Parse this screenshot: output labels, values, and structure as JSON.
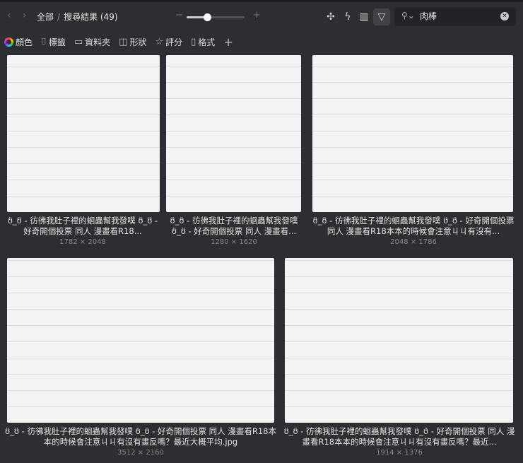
{
  "toolbar": {
    "back_icon": "chevron-left-icon",
    "forward_icon": "chevron-right-icon",
    "breadcrumb_root": "全部",
    "breadcrumb_current": "搜尋結果 (49)",
    "zoom_minus": "−",
    "zoom_plus": "+",
    "zoom_level": 0.35,
    "search_value": "肉棒"
  },
  "filters": [
    {
      "label": "顏色",
      "icon": "color-ring-icon"
    },
    {
      "label": "標籤",
      "icon": "bookmark-icon"
    },
    {
      "label": "資料夾",
      "icon": "folder-icon"
    },
    {
      "label": "形狀",
      "icon": "shape-icon"
    },
    {
      "label": "評分",
      "icon": "star-icon"
    },
    {
      "label": "格式",
      "icon": "file-format-icon"
    }
  ],
  "items": [
    {
      "caption": "ʊ̈_ʊ̈ - 彷彿我肚子裡的蛔蟲幫我發噗 ʊ̈_ʊ̈ - 好奇開個投票 同人 漫畫看R18...",
      "size": "1782 × 2048"
    },
    {
      "caption": "ʊ̈_ʊ̈ - 彷彿我肚子裡的蛔蟲幫我發噗 ʊ̈_ʊ̈ - 好奇開個投票 同人 漫畫看...",
      "size": "1280 × 1620"
    },
    {
      "caption": "ʊ̈_ʊ̈ - 彷彿我肚子裡的蛔蟲幫我發噗 ʊ̈_ʊ̈ - 好奇開個投票 同人 漫畫看R18本本的時候會注意ㄐㄐ有沒有...",
      "size": "2048 × 1786"
    },
    {
      "caption": "ʊ̈_ʊ̈ - 彷彿我肚子裡的蛔蟲幫我發噗 ʊ̈_ʊ̈ - 好奇開個投票 同人 漫畫看R18本本的時候會注意ㄐㄐ有沒有畫反嗎？最近大概平均.jpg",
      "size": "3512 × 2160"
    },
    {
      "caption": "ʊ̈_ʊ̈ - 彷彿我肚子裡的蛔蟲幫我發噗 ʊ̈_ʊ̈ - 好奇開個投票 同人 漫畫看R18本本的時候會注意ㄐㄐ有沒有畫反嗎？最近...",
      "size": "1914 × 1376"
    }
  ]
}
